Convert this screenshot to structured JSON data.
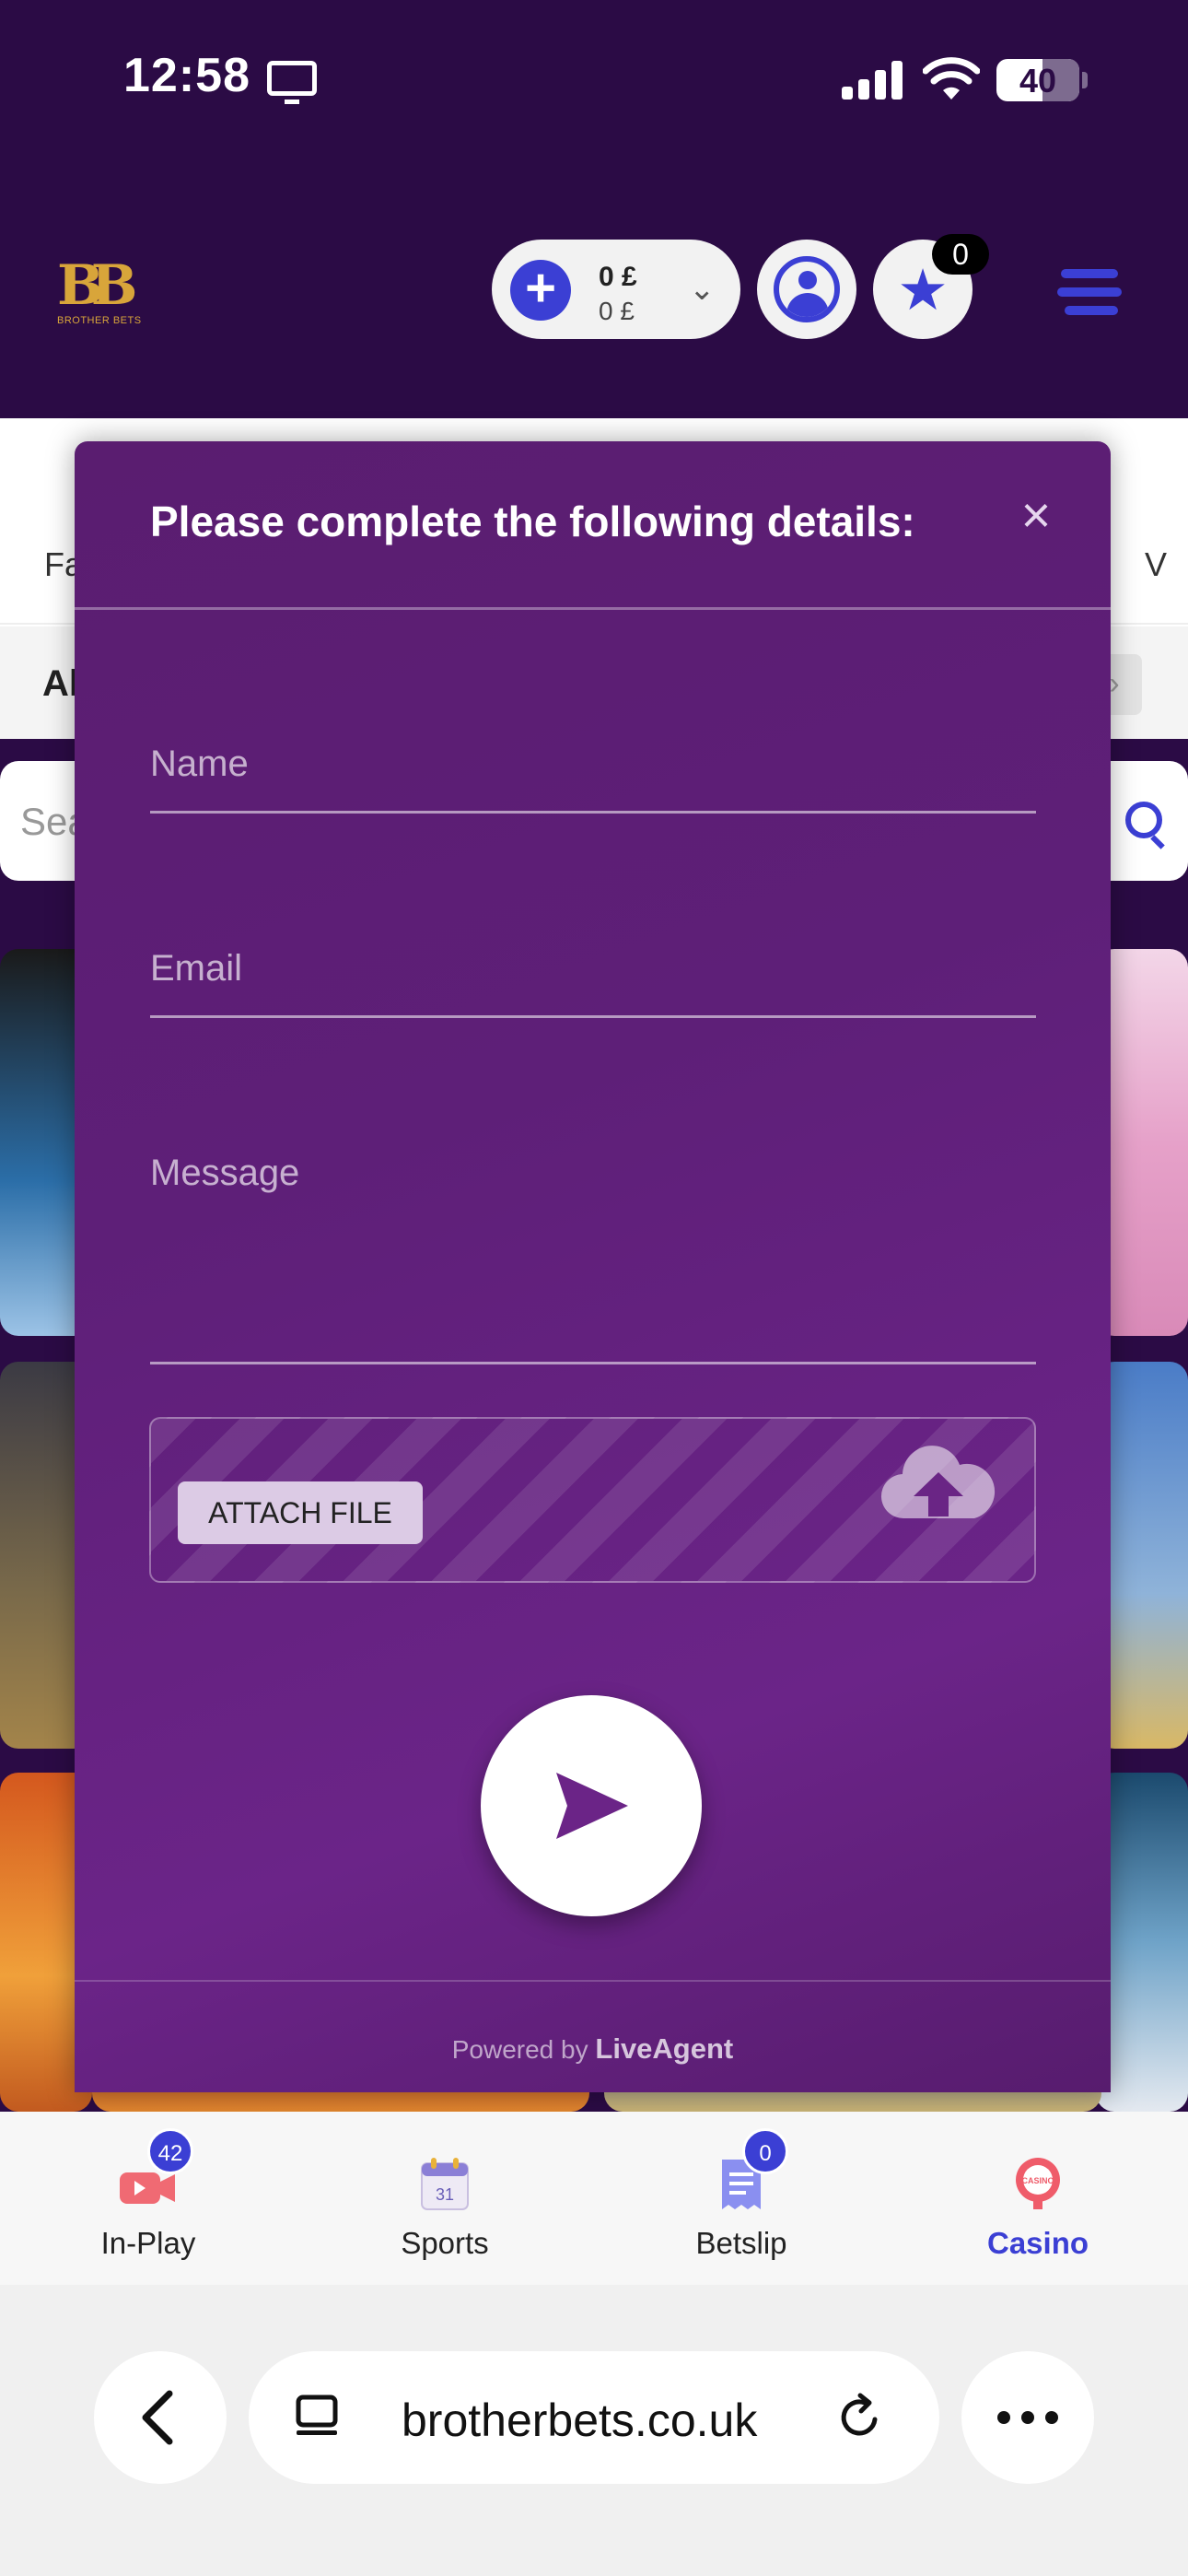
{
  "status_bar": {
    "time": "12:58",
    "battery": "40"
  },
  "header": {
    "logo_text": "BB",
    "logo_sub": "BROTHER BETS",
    "balance_main": "0 £",
    "balance_bonus": "0 £",
    "favorites_count": "0"
  },
  "background_page": {
    "tab_left_partial": "Fa",
    "tab_right_partial": "V",
    "filter_partial": "Al",
    "search_placeholder_partial": "Sea"
  },
  "modal": {
    "title": "Please complete the following details:",
    "close_glyph": "×",
    "name_placeholder": "Name",
    "email_placeholder": "Email",
    "message_placeholder": "Message",
    "attach_label": "ATTACH FILE",
    "powered_prefix": "Powered by",
    "powered_brand": "LiveAgent"
  },
  "bottom_nav": {
    "items": [
      {
        "label": "In-Play",
        "badge": "42",
        "icon": "live-camera-icon"
      },
      {
        "label": "Sports",
        "icon": "calendar-icon",
        "calendar_day": "31"
      },
      {
        "label": "Betslip",
        "badge": "0",
        "icon": "betslip-icon"
      },
      {
        "label": "Casino",
        "icon": "casino-chip-icon",
        "chip_text": "CASINO",
        "active": true
      }
    ]
  },
  "browser": {
    "url": "brotherbets.co.uk"
  },
  "colors": {
    "header_bg": "#2b0b45",
    "accent": "#3b3fd4",
    "modal_purple": "#5e1f78",
    "logo_gold": "#d8a53a"
  }
}
